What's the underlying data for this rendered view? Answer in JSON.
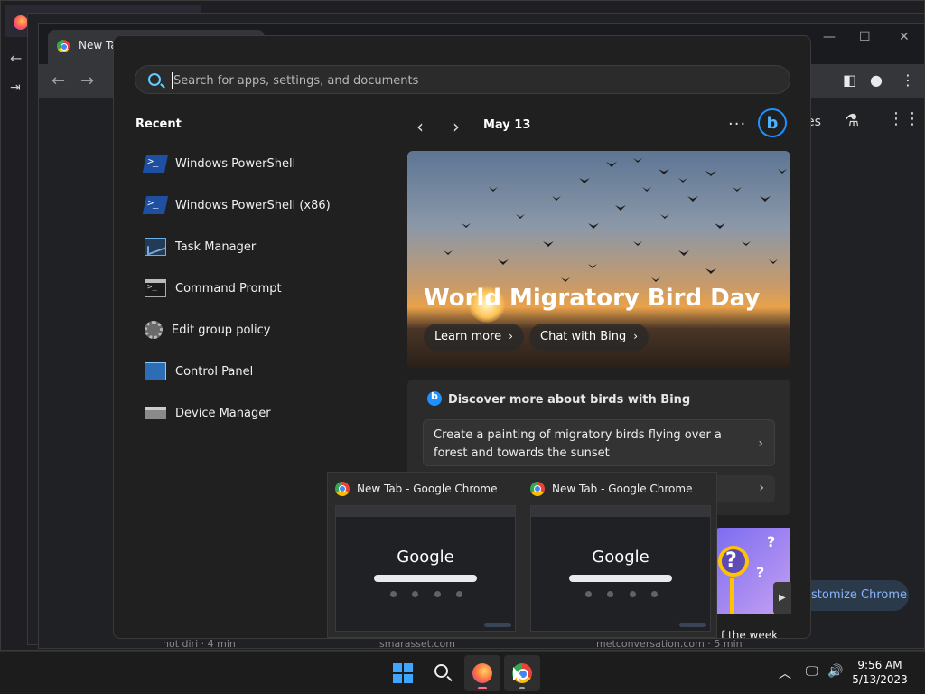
{
  "background": {
    "chrome_tab_title": "New Tab",
    "links": [
      "hot diri · 4 min",
      "smarasset.com",
      "metconversation.com · 5 min"
    ],
    "toolbar_partial": "es",
    "customize_label": "stomize Chrome"
  },
  "start_menu": {
    "search": {
      "placeholder": "Search for apps, settings, and documents"
    },
    "recent_title": "Recent",
    "recent_items": [
      {
        "label": "Windows PowerShell",
        "icon": "powershell-icon"
      },
      {
        "label": "Windows PowerShell (x86)",
        "icon": "powershell-icon"
      },
      {
        "label": "Task Manager",
        "icon": "task-manager-icon"
      },
      {
        "label": "Command Prompt",
        "icon": "command-prompt-icon"
      },
      {
        "label": "Edit group policy",
        "icon": "group-policy-icon"
      },
      {
        "label": "Control Panel",
        "icon": "control-panel-icon"
      },
      {
        "label": "Device Manager",
        "icon": "device-manager-icon"
      }
    ],
    "feed": {
      "date": "May 13",
      "hero_title": "World Migratory Bird Day",
      "learn_more": "Learn more",
      "chat_with_bing": "Chat with Bing",
      "discover_title": "Discover more about birds with Bing",
      "prompt_1": "Create a painting of migratory birds flying over a forest and towards the sunset",
      "week_caption": "f the week"
    }
  },
  "thumbnails": [
    {
      "title": "New Tab - Google Chrome",
      "preview_logo": "Google"
    },
    {
      "title": "New Tab - Google Chrome",
      "preview_logo": "Google"
    }
  ],
  "taskbar": {
    "clock_time": "9:56 AM",
    "clock_date": "5/13/2023"
  }
}
